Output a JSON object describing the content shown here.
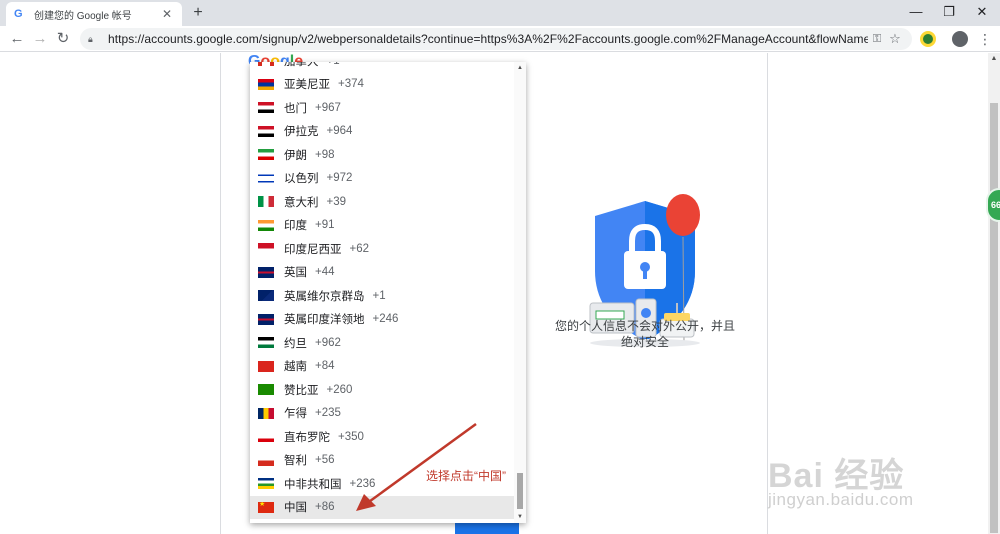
{
  "browser": {
    "tab_title": "创建您的 Google 帐号",
    "tab_favicon": "G",
    "new_tab_label": "+",
    "url": "https://accounts.google.com/signup/v2/webpersonaldetails?continue=https%3A%2F%2Faccounts.google.com%2FManageAccount&flowName=GlifWe...",
    "window_controls": [
      "minimize-icon",
      "restore-icon",
      "close-icon"
    ]
  },
  "page": {
    "logo_text": [
      "G",
      "o",
      "o",
      "g",
      "l",
      "e"
    ],
    "logo_colors": [
      "#4285f4",
      "#ea4335",
      "#fbbc05",
      "#4285f4",
      "#34a853",
      "#ea4335"
    ],
    "privacy_line1": "您的个人信息不会对外公开，并且",
    "privacy_line2": "绝对安全",
    "badge_text": "66"
  },
  "dropdown": {
    "items": [
      {
        "name": "加拿大",
        "code": "+1",
        "flag": "ca"
      },
      {
        "name": "亚美尼亚",
        "code": "+374",
        "flag": "am"
      },
      {
        "name": "也门",
        "code": "+967",
        "flag": "ye"
      },
      {
        "name": "伊拉克",
        "code": "+964",
        "flag": "iq"
      },
      {
        "name": "伊朗",
        "code": "+98",
        "flag": "ir"
      },
      {
        "name": "以色列",
        "code": "+972",
        "flag": "il"
      },
      {
        "name": "意大利",
        "code": "+39",
        "flag": "it"
      },
      {
        "name": "印度",
        "code": "+91",
        "flag": "in"
      },
      {
        "name": "印度尼西亚",
        "code": "+62",
        "flag": "id"
      },
      {
        "name": "英国",
        "code": "+44",
        "flag": "gb"
      },
      {
        "name": "英属维尔京群岛",
        "code": "+1",
        "flag": "vg"
      },
      {
        "name": "英属印度洋领地",
        "code": "+246",
        "flag": "gb"
      },
      {
        "name": "约旦",
        "code": "+962",
        "flag": "jo"
      },
      {
        "name": "越南",
        "code": "+84",
        "flag": "vn"
      },
      {
        "name": "赞比亚",
        "code": "+260",
        "flag": "zm"
      },
      {
        "name": "乍得",
        "code": "+235",
        "flag": "td"
      },
      {
        "name": "直布罗陀",
        "code": "+350",
        "flag": "gi"
      },
      {
        "name": "智利",
        "code": "+56",
        "flag": "cl"
      },
      {
        "name": "中非共和国",
        "code": "+236",
        "flag": "cf"
      },
      {
        "name": "中国",
        "code": "+86",
        "flag": "cn",
        "selected": true
      }
    ]
  },
  "annotation": {
    "text": "选择点击“中国”",
    "color": "#c0392b"
  },
  "watermark": {
    "text": "Bai 经验",
    "sub": "jingyan.baidu.com"
  }
}
